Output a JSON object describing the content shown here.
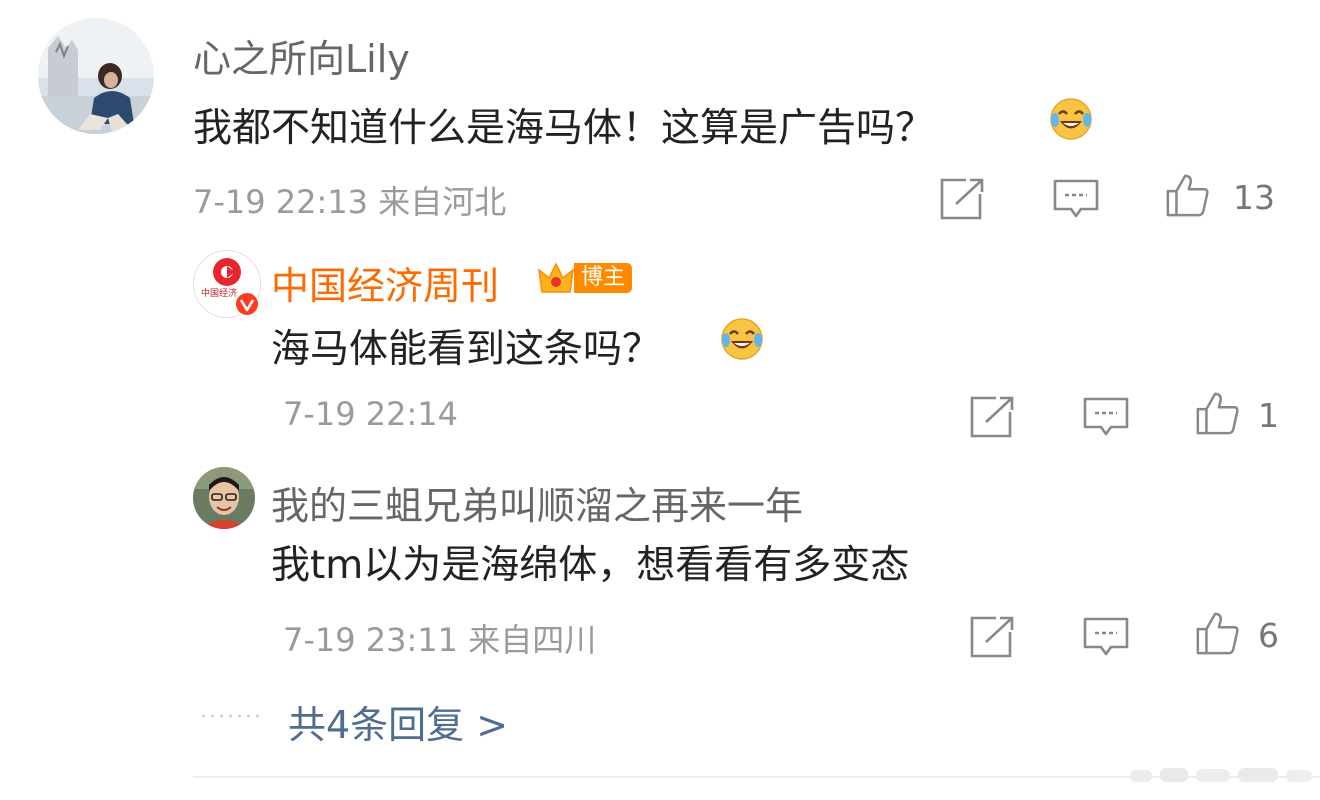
{
  "comment": {
    "username": "心之所向Lily",
    "text": "我都不知道什么是海马体！这算是广告吗？",
    "emoji_icon": "laughing-crying-emoji-icon",
    "meta": "7-19 22:13 来自河北",
    "like_count": "13"
  },
  "replies": [
    {
      "username": "中国经济周刊",
      "badge_label": "博主",
      "avatar_text": "中国经济",
      "text": "海马体能看到这条吗？",
      "emoji_icon": "laughing-crying-emoji-icon",
      "meta": "7-19 22:14",
      "like_count": "1"
    },
    {
      "username": "我的三蛆兄弟叫顺溜之再来一年",
      "text": "我tm以为是海绵体，想看看有多变态",
      "meta": "7-19 23:11 来自四川",
      "like_count": "6"
    }
  ],
  "more_replies": "共4条回复 >",
  "colors": {
    "username_vip": "#ff6a00",
    "link": "#4f6d90",
    "meta": "#9a9a9a",
    "verified": "#ff3b1f"
  }
}
